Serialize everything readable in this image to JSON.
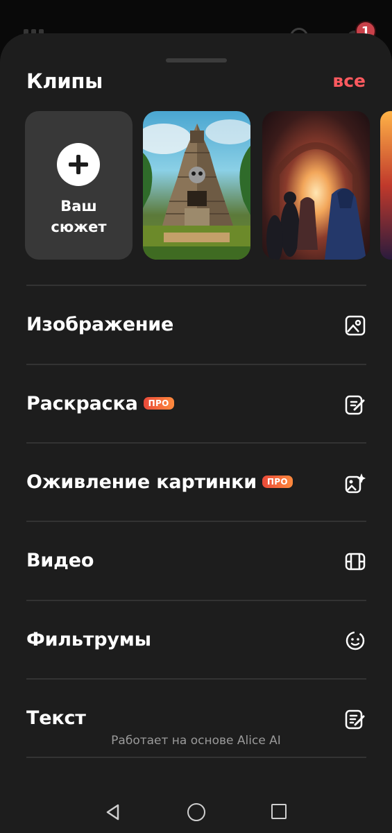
{
  "background": {
    "notification_count": "1"
  },
  "clips": {
    "title": "Клипы",
    "all_link": "все",
    "new_card_label": "Ваш\nсюжет",
    "thumbnails": [
      "pyramid-raccoon",
      "fantasy-tunnel-crowd",
      "partial-clip"
    ]
  },
  "menu": [
    {
      "label": "Изображение",
      "pro": false,
      "icon": "image-icon"
    },
    {
      "label": "Раскраска",
      "pro": true,
      "pro_label": "ПРО",
      "icon": "edit-image-icon"
    },
    {
      "label": "Оживление картинки",
      "pro": true,
      "pro_label": "ПРО",
      "icon": "sparkle-image-icon"
    },
    {
      "label": "Видео",
      "pro": false,
      "icon": "film-icon"
    },
    {
      "label": "Фильтрумы",
      "pro": false,
      "icon": "face-filter-icon"
    },
    {
      "label": "Текст",
      "pro": false,
      "icon": "text-edit-icon"
    }
  ],
  "footer": {
    "text": "Работает на основе Alice AI"
  },
  "colors": {
    "sheet": "#1d1d1d",
    "accent": "#ff5a5f",
    "pro_gradient_start": "#e94a3a",
    "pro_gradient_end": "#ff8a3d"
  }
}
